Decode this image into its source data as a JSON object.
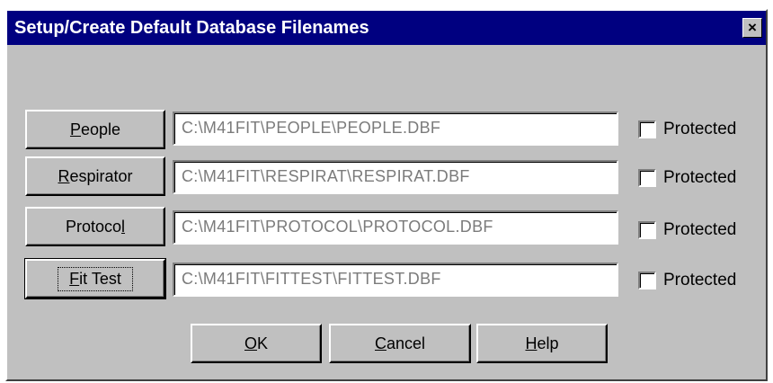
{
  "window": {
    "title": "Setup/Create Default Database Filenames",
    "close_glyph": "×",
    "titlebar_color": "#000080",
    "face_color": "#c0c0c0"
  },
  "rows": [
    {
      "button_pre": "",
      "button_mn": "P",
      "button_post": "eople",
      "path": "C:\\M41FIT\\PEOPLE\\PEOPLE.DBF",
      "checkbox_label": "Protected",
      "checked": false
    },
    {
      "button_pre": "",
      "button_mn": "R",
      "button_post": "espirator",
      "path": "C:\\M41FIT\\RESPIRAT\\RESPIRAT.DBF",
      "checkbox_label": "Protected",
      "checked": false
    },
    {
      "button_pre": "Protoco",
      "button_mn": "l",
      "button_post": "",
      "path": "C:\\M41FIT\\PROTOCOL\\PROTOCOL.DBF",
      "checkbox_label": "Protected",
      "checked": false
    },
    {
      "button_pre": "",
      "button_mn": "F",
      "button_post": "it Test",
      "path": "C:\\M41FIT\\FITTEST\\FITTEST.DBF",
      "checkbox_label": "Protected",
      "checked": false
    }
  ],
  "actions": {
    "ok": {
      "mn": "O",
      "rest": "K"
    },
    "cancel": {
      "mn": "C",
      "rest": "ancel"
    },
    "help": {
      "mn": "H",
      "rest": "elp"
    }
  }
}
